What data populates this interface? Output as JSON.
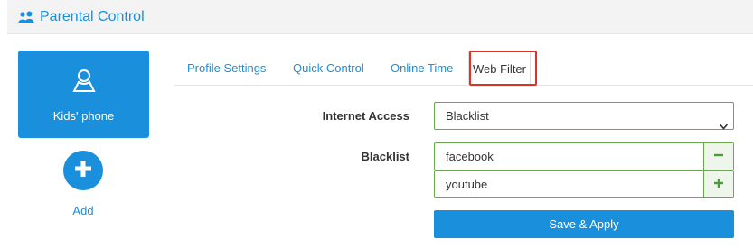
{
  "header": {
    "title": "Parental Control",
    "icon": "users-icon"
  },
  "sidebar": {
    "profile": {
      "label": "Kids' phone",
      "icon": "user-outline-icon"
    },
    "add": {
      "label": "Add",
      "icon": "plus-icon"
    }
  },
  "tabs": [
    {
      "label": "Profile Settings"
    },
    {
      "label": "Quick Control"
    },
    {
      "label": "Online Time"
    },
    {
      "label": "Web Filter",
      "active": true
    }
  ],
  "form": {
    "internet_access": {
      "label": "Internet Access",
      "value": "Blacklist"
    },
    "blacklist": {
      "label": "Blacklist",
      "items": [
        {
          "value": "facebook",
          "action": "minus-icon"
        },
        {
          "value": "youtube",
          "action": "plus-icon"
        }
      ]
    },
    "save_label": "Save & Apply"
  },
  "colors": {
    "accent": "#1a8fdb",
    "field_border": "#6aa84f",
    "highlight": "#e0302a"
  }
}
